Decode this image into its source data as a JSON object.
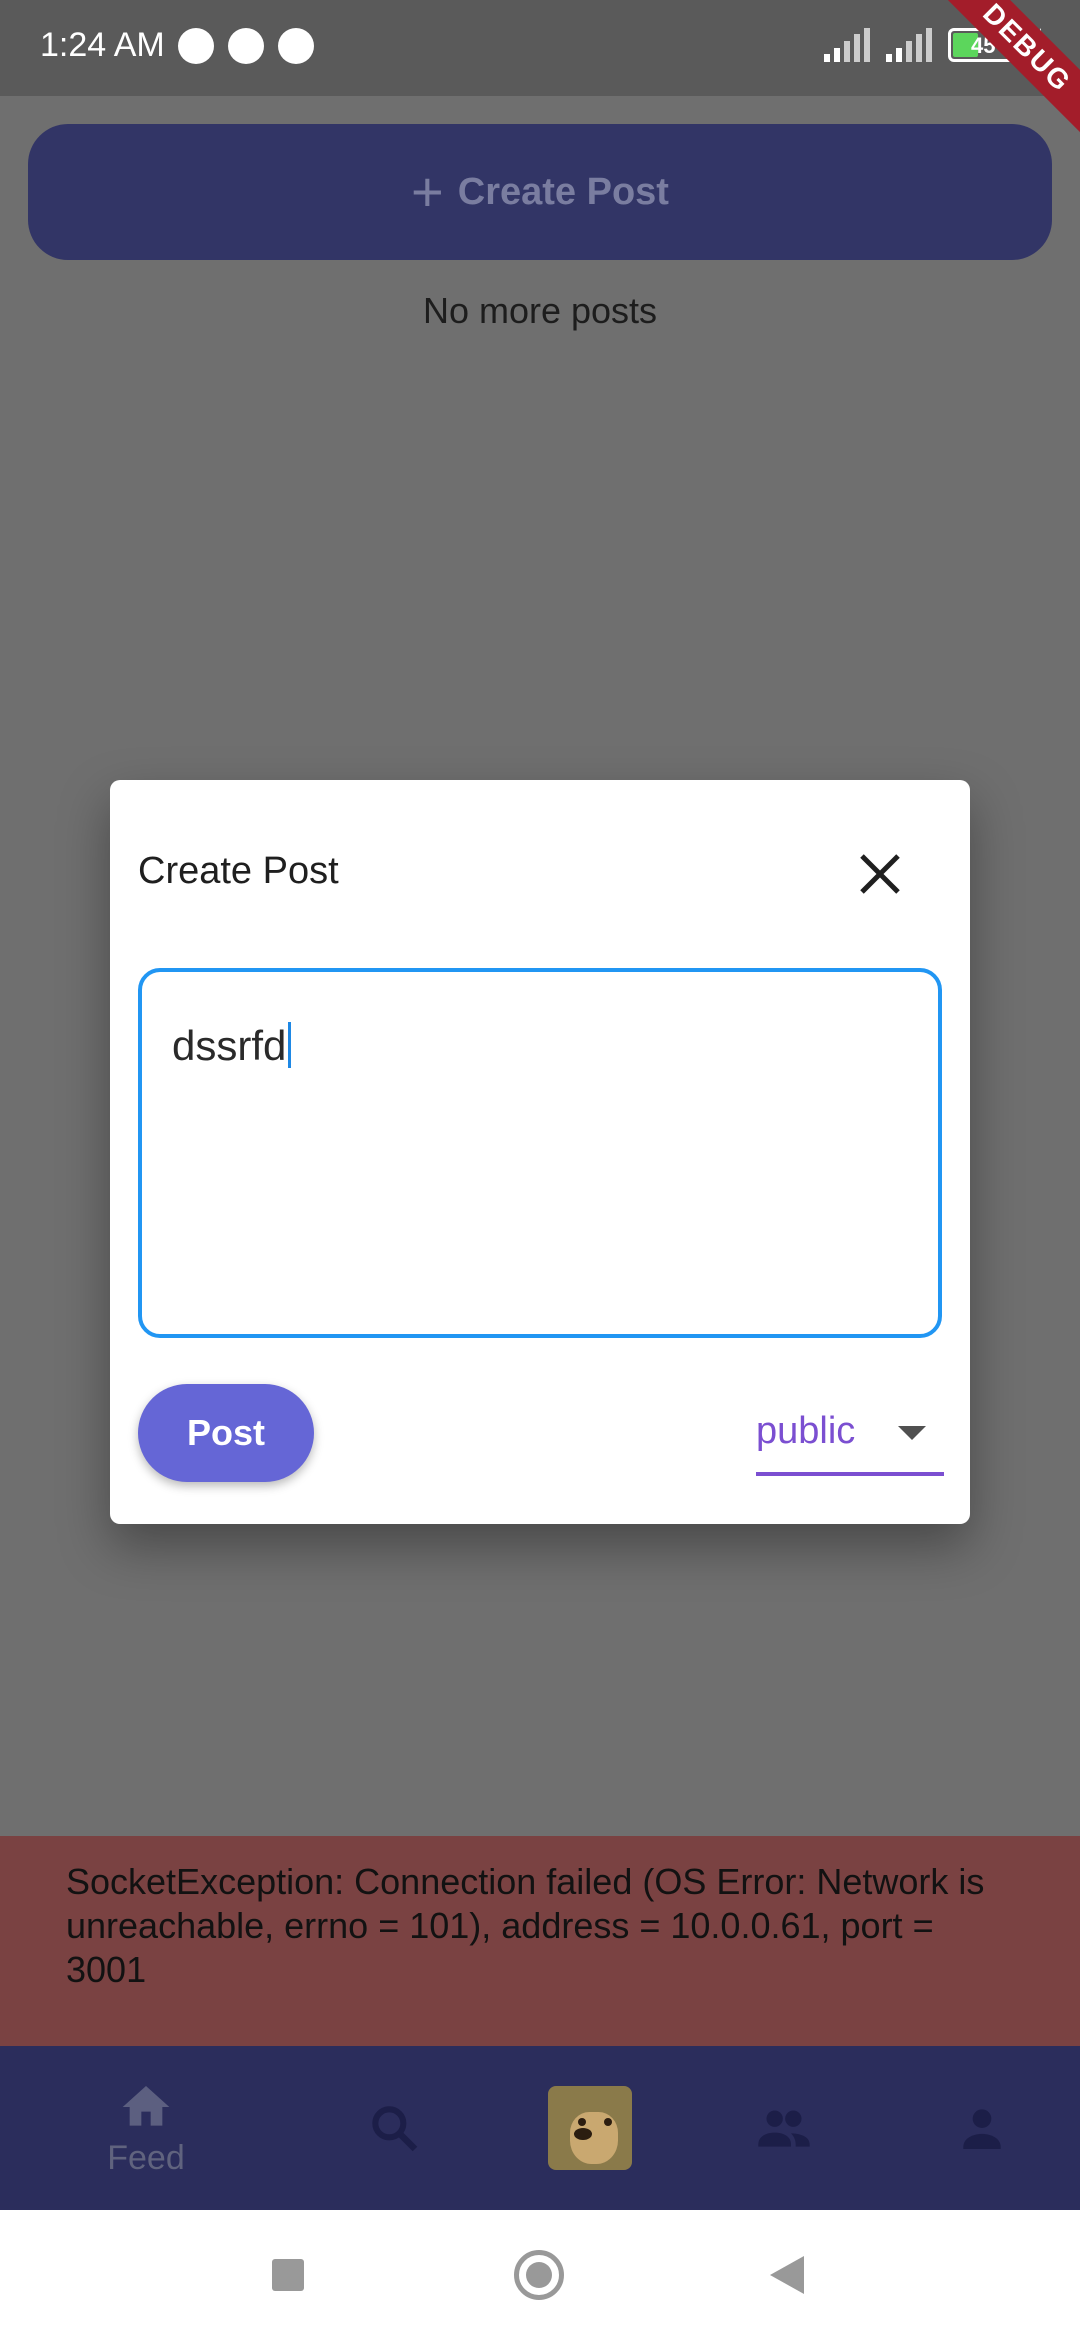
{
  "status_bar": {
    "time": "1:24 AM",
    "battery": "45",
    "debug_label": "DEBUG"
  },
  "main": {
    "create_post_button": "Create Post",
    "end_message": "No more posts"
  },
  "dialog": {
    "title": "Create Post",
    "input_value": "dssrfd",
    "post_button": "Post",
    "visibility_selected": "public"
  },
  "error": {
    "message": "SocketException: Connection failed (OS Error: Network is unreachable, errno = 101), address = 10.0.0.61, port = 3001"
  },
  "bottom_nav": {
    "items": [
      {
        "icon": "home-icon",
        "label": "Feed"
      },
      {
        "icon": "search-icon",
        "label": ""
      },
      {
        "icon": "doge-avatar",
        "label": ""
      },
      {
        "icon": "people-icon",
        "label": ""
      },
      {
        "icon": "person-icon",
        "label": ""
      }
    ]
  },
  "colors": {
    "accent_purple": "#7b4fd1",
    "post_button": "#6566d6",
    "input_border": "#2196f3",
    "nav_background": "#2b2d5c",
    "error_background": "#7a4242"
  }
}
